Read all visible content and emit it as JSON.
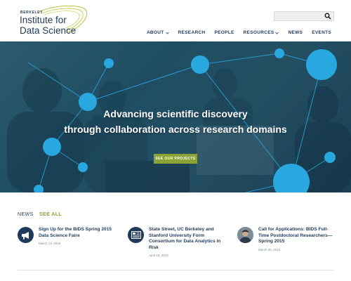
{
  "logo": {
    "berkeley": "BERKELEY",
    "line1": "Institute for",
    "line2": "Data Science",
    "accent": "#b8c230"
  },
  "search": {
    "placeholder": "",
    "icon": "search-icon"
  },
  "nav": {
    "items": [
      {
        "label": "ABOUT",
        "dropdown": true
      },
      {
        "label": "RESEARCH",
        "dropdown": false
      },
      {
        "label": "PEOPLE",
        "dropdown": false
      },
      {
        "label": "RESOURCES",
        "dropdown": true
      },
      {
        "label": "NEWS",
        "dropdown": false
      },
      {
        "label": "EVENTS",
        "dropdown": false
      }
    ]
  },
  "hero": {
    "title_line1": "Advancing scientific discovery",
    "title_line2": "through collaboration across research domains",
    "button_label": "SEE OUR PROJECTS",
    "bubble_color": "#29a8e0"
  },
  "news": {
    "label": "NEWS",
    "see_all": "SEE ALL",
    "items": [
      {
        "title": "Sign Up for the BIDS Spring 2015 Data Science Faire",
        "date": "March 13, 2015",
        "icon": "megaphone-icon"
      },
      {
        "title": "State Street, UC Berkeley and Stanford University Form Consortium for Data Analytics in Risk",
        "date": "April 15, 2015",
        "icon": "newspaper-icon"
      },
      {
        "title": "Call for Applications: BIDS Full-Time Postdoctoral Researchers—Spring 2015",
        "date": "March 30, 2015",
        "icon": "person-avatar"
      }
    ]
  },
  "colors": {
    "navy": "#1f3a5a",
    "green": "#8aa337",
    "cyan": "#29a8e0"
  }
}
